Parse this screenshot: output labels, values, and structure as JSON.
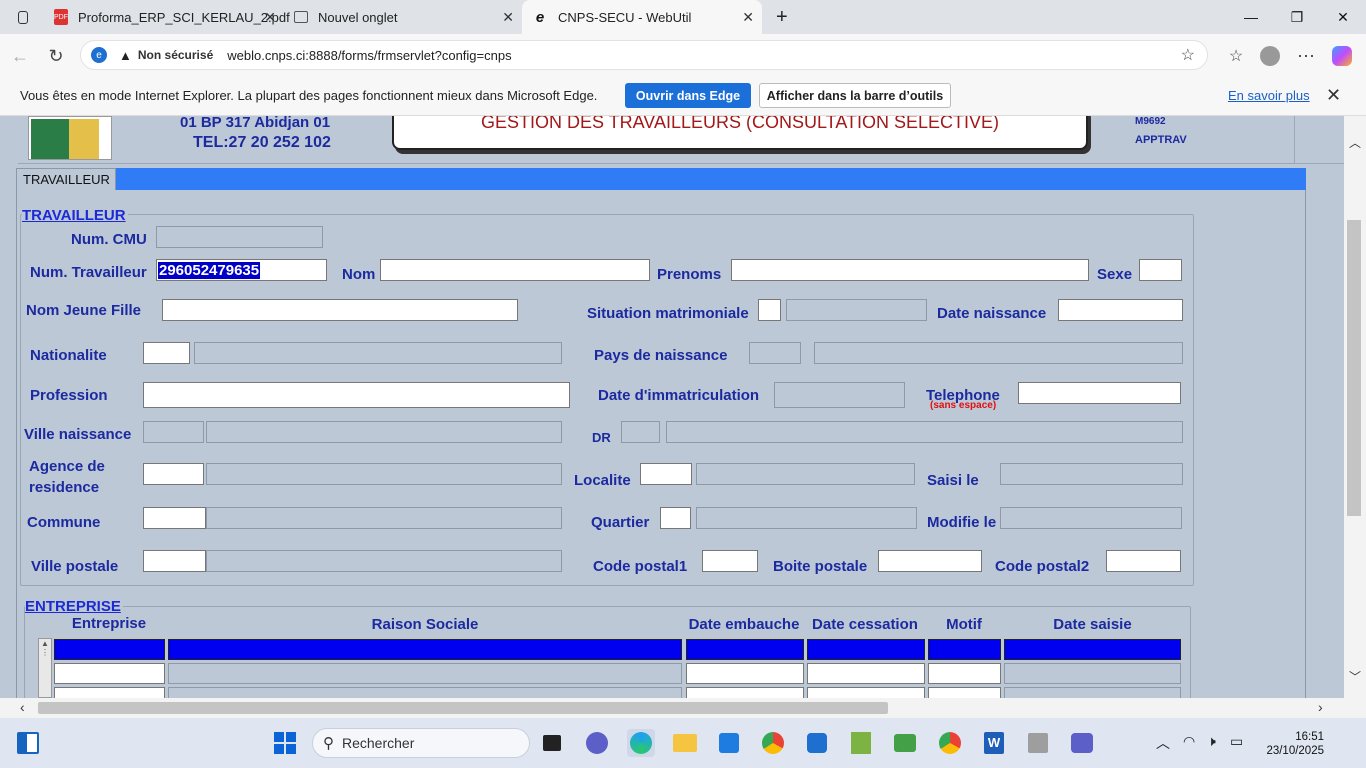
{
  "browser": {
    "tabs": [
      {
        "label": "Proforma_ERP_SCI_KERLAU_2.pdf",
        "icon": "pdf-icon"
      },
      {
        "label": "Nouvel onglet",
        "icon": "new-tab-icon"
      },
      {
        "label": "CNPS-SECU - WebUtil",
        "icon": "ie-icon"
      }
    ],
    "security_label": "Non sécurisé",
    "url": "weblo.cnps.ci:8888/forms/frmservlet?config=cnps",
    "infobar_message": "Vous êtes en mode Internet Explorer. La plupart des pages fonctionnent mieux dans Microsoft Edge.",
    "open_in_edge": "Ouvrir dans Edge",
    "show_in_toolbar": "Afficher dans la barre d’outils",
    "learn_more": "En savoir plus"
  },
  "app": {
    "address_line1": "01 BP 317 Abidjan 01",
    "address_line2": "TEL:27 20 252 102",
    "title": "GESTION DES TRAVAILLEURS (CONSULTATION SELECTIVE)",
    "code1": "M9692",
    "code2": "APPTRAV",
    "tab_label": "TRAVAILLEUR"
  },
  "travailleur": {
    "section_title": "TRAVAILLEUR",
    "labels": {
      "num_cmu": "Num. CMU",
      "num_travailleur": "Num. Travailleur",
      "nom": "Nom",
      "prenoms": "Prenoms",
      "sexe": "Sexe",
      "nom_jeune_fille": "Nom Jeune Fille",
      "situation_matrimoniale": "Situation matrimoniale",
      "date_naissance": "Date naissance",
      "nationalite": "Nationalite",
      "pays_naissance": "Pays de naissance",
      "profession": "Profession",
      "date_immatriculation": "Date d'immatriculation",
      "telephone": "Telephone",
      "telephone_hint": "(sans espace)",
      "ville_naissance": "Ville naissance",
      "dr": "DR",
      "agence_residence_1": "Agence de",
      "agence_residence_2": "residence",
      "localite": "Localite",
      "saisi_le": "Saisi le",
      "commune": "Commune",
      "quartier": "Quartier",
      "modifie_le": "Modifie le",
      "ville_postale": "Ville postale",
      "code_postal1": "Code postal1",
      "boite_postale": "Boite postale",
      "code_postal2": "Code postal2"
    },
    "values": {
      "num_travailleur": "296052479635"
    }
  },
  "entreprise": {
    "section_title": "ENTREPRISE",
    "columns": [
      "Entreprise",
      "Raison Sociale",
      "Date embauche",
      "Date cessation",
      "Motif",
      "Date saisie"
    ]
  },
  "taskbar": {
    "search_placeholder": "Rechercher",
    "time": "16:51",
    "date": "23/10/2025"
  }
}
